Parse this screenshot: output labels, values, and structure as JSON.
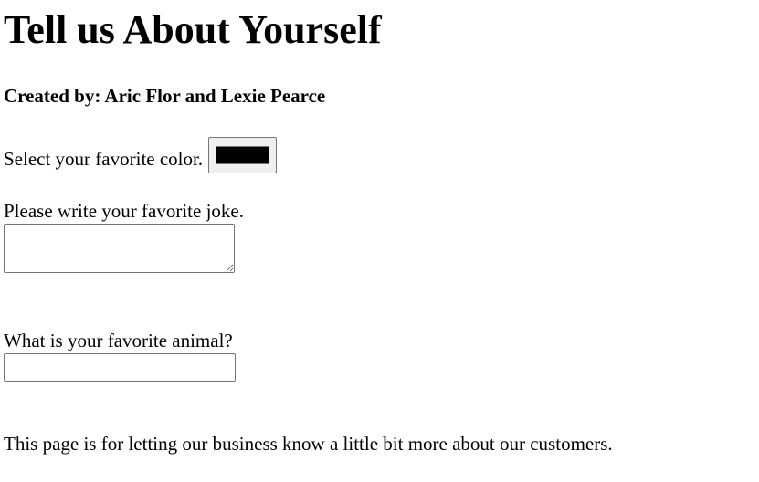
{
  "page": {
    "title": "Tell us About Yourself",
    "credits": "Created by: Aric Flor and Lexie Pearce"
  },
  "form": {
    "color": {
      "label": "Select your favorite color.",
      "value": "#000000"
    },
    "joke": {
      "label": "Please write your favorite joke.",
      "value": ""
    },
    "animal": {
      "label": "What is your favorite animal?",
      "value": ""
    }
  },
  "footer": {
    "text": "This page is for letting our business know a little bit more about our customers."
  }
}
